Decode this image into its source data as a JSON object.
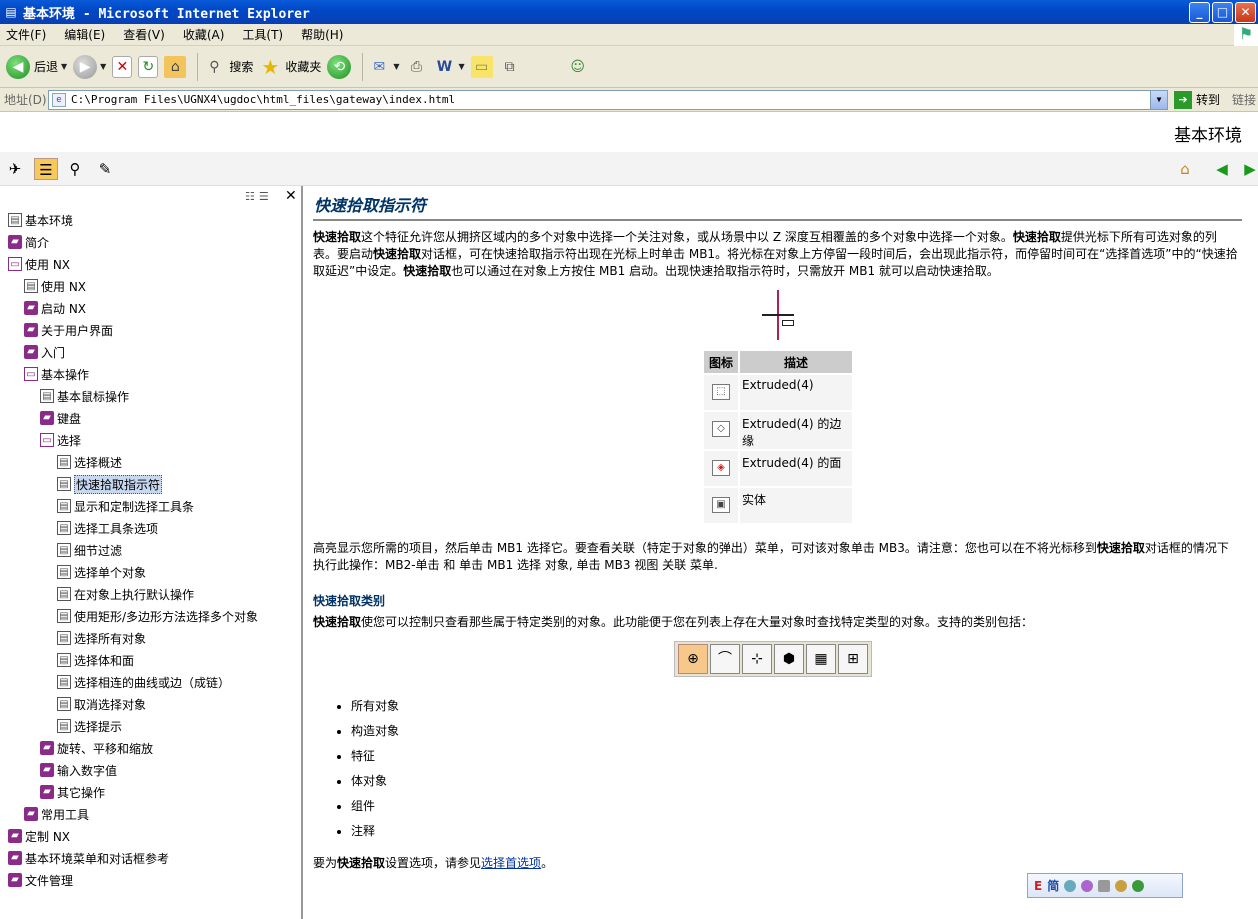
{
  "window": {
    "title": "基本环境 - Microsoft Internet Explorer",
    "minimize": "_",
    "maximize": "□",
    "close": "✕"
  },
  "menu": [
    "文件(F)",
    "编辑(E)",
    "查看(V)",
    "收藏(A)",
    "工具(T)",
    "帮助(H)"
  ],
  "toolbar": {
    "back_label": "后退",
    "search_label": "搜索",
    "favorites_label": "收藏夹"
  },
  "address": {
    "label": "地址(D)",
    "url": "C:\\Program Files\\UGNX4\\ugdoc\\html_files\\gateway\\index.html",
    "go_label": "转到",
    "links_label": "链接"
  },
  "doc_header_title": "基本环境",
  "sidebar": {
    "tree": [
      {
        "label": "基本环境",
        "icon": "page",
        "level": 0
      },
      {
        "label": "简介",
        "icon": "book",
        "level": 0
      },
      {
        "label": "使用 NX",
        "icon": "open-book",
        "level": 0
      },
      {
        "label": "使用 NX",
        "icon": "page",
        "level": 1
      },
      {
        "label": "启动 NX",
        "icon": "book",
        "level": 1
      },
      {
        "label": "关于用户界面",
        "icon": "book",
        "level": 1
      },
      {
        "label": "入门",
        "icon": "book",
        "level": 1
      },
      {
        "label": "基本操作",
        "icon": "open-book",
        "level": 1
      },
      {
        "label": "基本鼠标操作",
        "icon": "page",
        "level": 2
      },
      {
        "label": "键盘",
        "icon": "book",
        "level": 2
      },
      {
        "label": "选择",
        "icon": "open-book",
        "level": 2
      },
      {
        "label": "选择概述",
        "icon": "page",
        "level": 3
      },
      {
        "label": "快速拾取指示符",
        "icon": "page",
        "level": 3,
        "selected": true
      },
      {
        "label": "显示和定制选择工具条",
        "icon": "page",
        "level": 3
      },
      {
        "label": "选择工具条选项",
        "icon": "page",
        "level": 3
      },
      {
        "label": "细节过滤",
        "icon": "page",
        "level": 3
      },
      {
        "label": "选择单个对象",
        "icon": "page",
        "level": 3
      },
      {
        "label": "在对象上执行默认操作",
        "icon": "page",
        "level": 3
      },
      {
        "label": "使用矩形/多边形方法选择多个对象",
        "icon": "page",
        "level": 3
      },
      {
        "label": "选择所有对象",
        "icon": "page",
        "level": 3
      },
      {
        "label": "选择体和面",
        "icon": "page",
        "level": 3
      },
      {
        "label": "选择相连的曲线或边（成链）",
        "icon": "page",
        "level": 3
      },
      {
        "label": "取消选择对象",
        "icon": "page",
        "level": 3
      },
      {
        "label": "选择提示",
        "icon": "page",
        "level": 3
      },
      {
        "label": "旋转、平移和缩放",
        "icon": "book",
        "level": 2
      },
      {
        "label": "输入数字值",
        "icon": "book",
        "level": 2
      },
      {
        "label": "其它操作",
        "icon": "book",
        "level": 2
      },
      {
        "label": "常用工具",
        "icon": "book",
        "level": 1
      },
      {
        "label": "定制 NX",
        "icon": "book",
        "level": 0
      },
      {
        "label": "基本环境菜单和对话框参考",
        "icon": "book",
        "level": 0
      },
      {
        "label": "文件管理",
        "icon": "book",
        "level": 0
      }
    ]
  },
  "content": {
    "title": "快速拾取指示符",
    "p1_parts": [
      "快速拾取",
      "这个特征允许您从拥挤区域内的多个对象中选择一个关注对象，或从场景中以 Z 深度互相覆盖的多个对象中选择一个对象。",
      "快速拾取",
      "提供光标下所有可选对象的列表。要启动",
      "快速拾取",
      "对话框，可在快速拾取指示符出现在光标上时单击 MB1。将光标在对象上方停留一段时间后，会出现此指示符，而停留时间可在“选择首选项”中的“快速拾取延迟”中设定。",
      "快速拾取",
      "也可以通过在对象上方按住 MB1 启动。出现快速拾取指示符时，只需放开 MB1 就可以启动快速拾取。"
    ],
    "table": {
      "headers": [
        "图标",
        "描述"
      ],
      "rows": [
        {
          "icon": "extruded-icon",
          "text": "Extruded(4)"
        },
        {
          "icon": "edge-icon",
          "text": "Extruded(4) 的边缘"
        },
        {
          "icon": "face-icon",
          "text": "Extruded(4) 的面"
        },
        {
          "icon": "solid-body-icon",
          "text": "实体"
        }
      ]
    },
    "p2_parts": [
      "高亮显示您所需的项目，然后单击 MB1 选择它。要查看关联（特定于对象的弹出）菜单，可对该对象单击 MB3。请注意：您也可以在不将光标移到",
      "快速拾取",
      "对话框的情况下执行此操作：MB2-单击 和 单击 MB1 选择 对象, 单击 MB3 视图 关联 菜单."
    ],
    "subheading": "快速拾取类别",
    "p3_parts": [
      "快速拾取",
      "使您可以控制只查看那些属于特定类别的对象。此功能便于您在列表上存在大量对象时查找特定类型的对象。支持的类别包括："
    ],
    "categories": [
      "所有对象",
      "构造对象",
      "特征",
      "体对象",
      "组件",
      "注释"
    ],
    "last_parts": [
      "要为",
      "快速拾取",
      "设置选项，请参见",
      "选择首选项",
      "。"
    ]
  },
  "ime": {
    "e": "E",
    "c": "简"
  }
}
